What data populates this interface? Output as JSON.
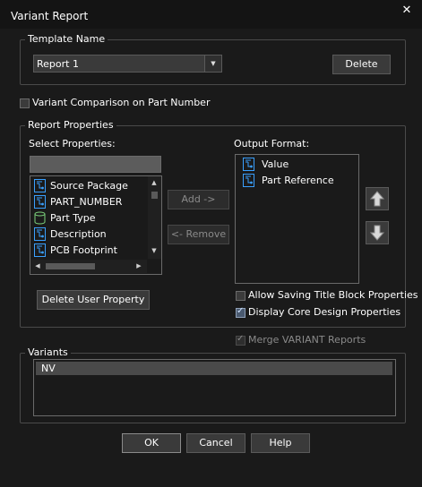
{
  "window": {
    "title": "Variant Report",
    "close_glyph": "✕"
  },
  "template": {
    "legend": "Template Name",
    "selected": "Report 1",
    "delete_label": "Delete"
  },
  "variant_comparison": {
    "label": "Variant Comparison on Part Number",
    "checked": false
  },
  "report_properties": {
    "legend": "Report Properties",
    "select_label": "Select Properties:",
    "search_value": "",
    "items": [
      {
        "label": "Source Package",
        "icon": "property-icon"
      },
      {
        "label": "PART_NUMBER",
        "icon": "property-icon"
      },
      {
        "label": "Part Type",
        "icon": "part-type-icon"
      },
      {
        "label": "Description",
        "icon": "property-icon"
      },
      {
        "label": "PCB Footprint",
        "icon": "property-icon"
      }
    ],
    "add_label": "Add ->",
    "remove_label": "<- Remove",
    "output_label": "Output Format:",
    "output_items": [
      {
        "label": "Value",
        "icon": "property-icon"
      },
      {
        "label": "Part Reference",
        "icon": "property-icon"
      }
    ],
    "delete_user_property_label": "Delete User Property",
    "allow_saving_label": "Allow Saving Title Block Properties",
    "allow_saving_checked": false,
    "display_core_label": "Display Core Design Properties",
    "display_core_checked": true
  },
  "merge": {
    "label": "Merge VARIANT Reports",
    "checked": true,
    "disabled": true
  },
  "variants": {
    "legend": "Variants",
    "items": [
      "NV"
    ]
  },
  "footer": {
    "ok_label": "OK",
    "cancel_label": "Cancel",
    "help_label": "Help"
  },
  "colors": {
    "background": "#1a1a1a",
    "control": "#3a3a3a",
    "icon_blue": "#3aa0ff",
    "icon_green": "#7cd17c"
  }
}
